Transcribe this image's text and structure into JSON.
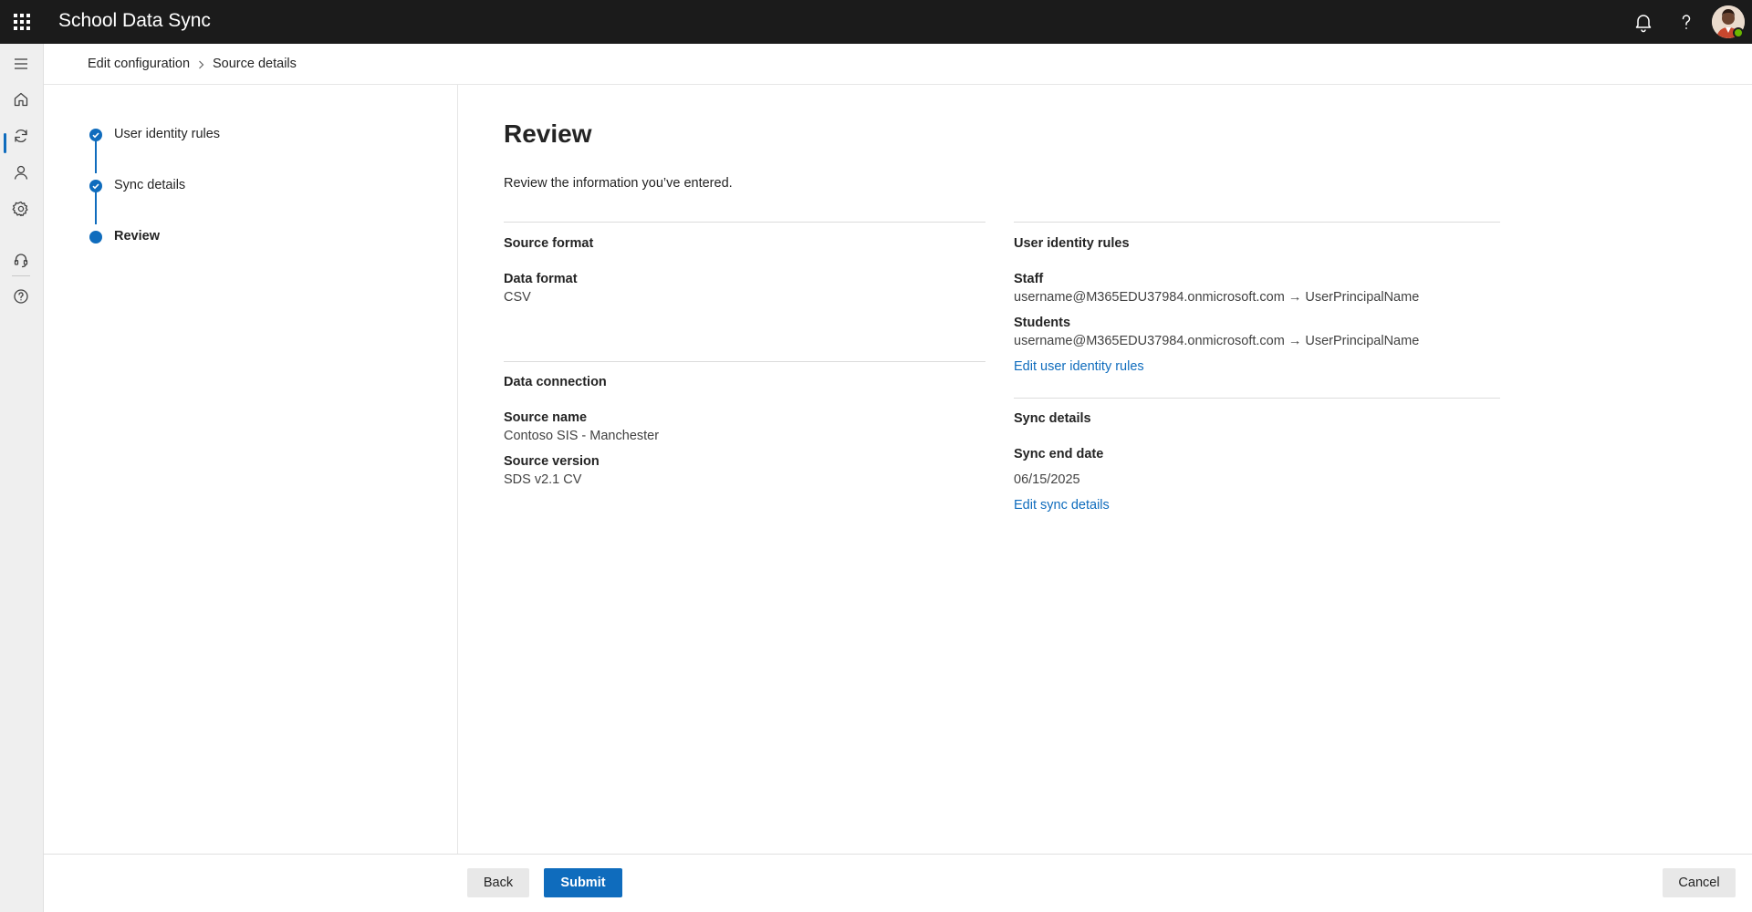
{
  "app": {
    "title": "School Data Sync"
  },
  "topbar": {
    "icons": [
      "waffle-icon",
      "bell-icon",
      "help-icon",
      "avatar"
    ]
  },
  "rail": {
    "icons": [
      "hamburger-icon",
      "home-icon",
      "sync-icon",
      "person-icon",
      "settings-icon",
      "headset-icon",
      "help-circle-icon"
    ],
    "active": "home-icon"
  },
  "breadcrumb": {
    "items": [
      "Edit configuration",
      "Source details"
    ]
  },
  "steps": {
    "items": [
      {
        "label": "User identity rules",
        "status": "complete"
      },
      {
        "label": "Sync details",
        "status": "complete"
      },
      {
        "label": "Review",
        "status": "current"
      }
    ]
  },
  "review": {
    "title": "Review",
    "description": "Review the information you’ve entered.",
    "source_format": {
      "title": "Source format",
      "data_format_label": "Data format",
      "data_format_value": "CSV"
    },
    "data_connection": {
      "title": "Data connection",
      "source_name_label": "Source name",
      "source_name_value": "Contoso SIS - Manchester",
      "source_version_label": "Source version",
      "source_version_value": "SDS v2.1 CV"
    },
    "user_identity_rules": {
      "title": "User identity rules",
      "staff_label": "Staff",
      "staff_value": "username@M365EDU37984.onmicrosoft.com → UserPrincipalName",
      "students_label": "Students",
      "students_value": "username@M365EDU37984.onmicrosoft.com → UserPrincipalName",
      "edit_link": "Edit user identity rules"
    },
    "sync_details": {
      "title": "Sync details",
      "end_date_label": "Sync end date",
      "end_date_value": "06/15/2025",
      "edit_link": "Edit sync details"
    }
  },
  "footer": {
    "back_label": "Back",
    "submit_label": "Submit",
    "cancel_label": "Cancel"
  },
  "colors": {
    "accent": "#0f6cbd",
    "topbar": "#1b1b1b",
    "rail": "#efefef",
    "presence": "#6bb700"
  }
}
